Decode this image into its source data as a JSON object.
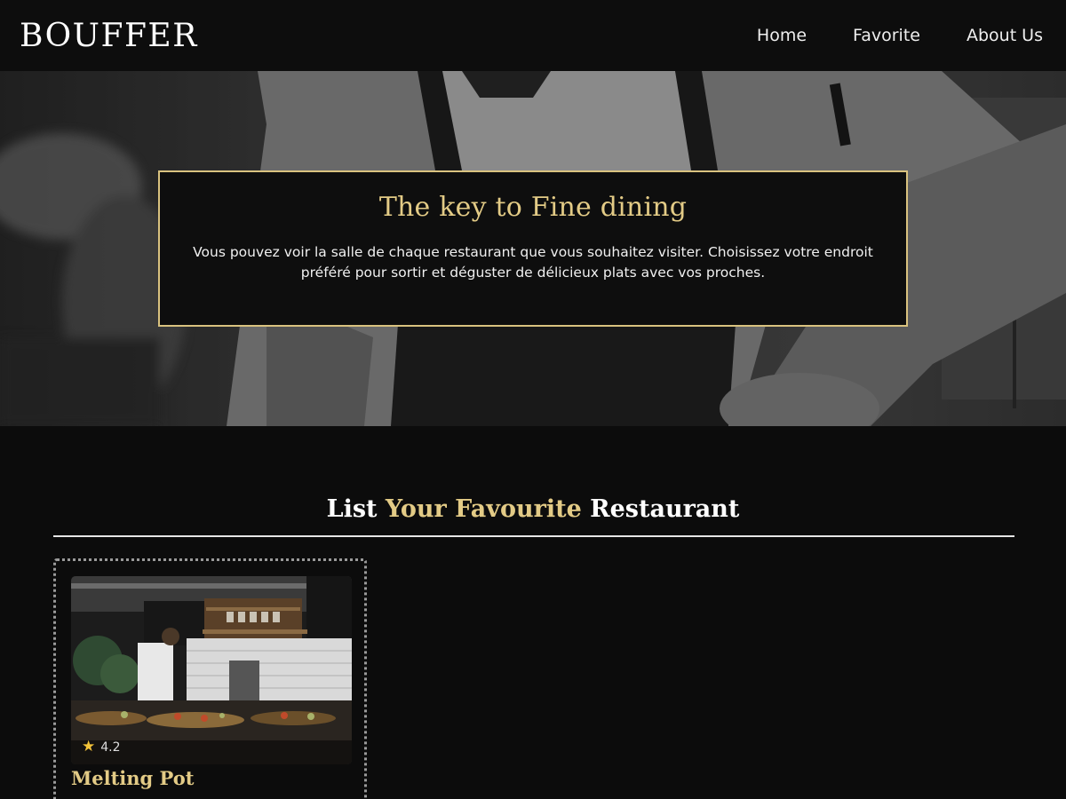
{
  "navbar": {
    "brand": "BOUFFER",
    "links": [
      "Home",
      "Favorite",
      "About Us"
    ]
  },
  "hero": {
    "title": "The key to Fine dining",
    "description": "Vous pouvez voir la salle de chaque restaurant que vous souhaitez visiter. Choisissez votre endroit préféré pour sortir et déguster de délicieux plats avec vos proches."
  },
  "section": {
    "title_part1": "List ",
    "title_accent": "Your Favourite",
    "title_part2": " Restaurant"
  },
  "restaurants": [
    {
      "name": "Melting Pot",
      "rating": "4.2"
    }
  ],
  "colors": {
    "accent_gold": "#e3cb86",
    "background": "#0c0c0c",
    "star": "#f4c43a"
  }
}
